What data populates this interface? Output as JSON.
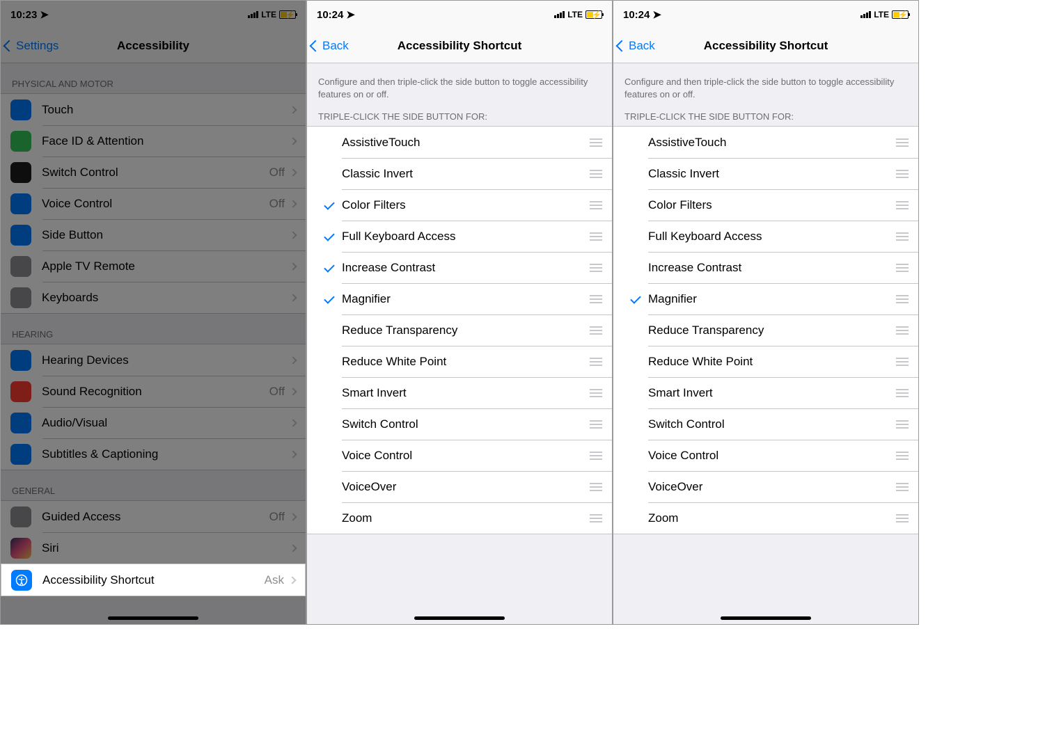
{
  "screen1": {
    "time": "10:23",
    "network": "LTE",
    "back_label": "Settings",
    "title": "Accessibility",
    "sections": {
      "physical": {
        "header": "PHYSICAL AND MOTOR",
        "items": [
          {
            "label": "Touch",
            "detail": "",
            "icon": "touch-icon",
            "bg": "bg-blue"
          },
          {
            "label": "Face ID & Attention",
            "detail": "",
            "icon": "face-icon",
            "bg": "bg-green"
          },
          {
            "label": "Switch Control",
            "detail": "Off",
            "icon": "switch-icon",
            "bg": "bg-dark"
          },
          {
            "label": "Voice Control",
            "detail": "Off",
            "icon": "voice-icon",
            "bg": "bg-blue"
          },
          {
            "label": "Side Button",
            "detail": "",
            "icon": "side-icon",
            "bg": "bg-blue"
          },
          {
            "label": "Apple TV Remote",
            "detail": "",
            "icon": "remote-icon",
            "bg": "bg-gray"
          },
          {
            "label": "Keyboards",
            "detail": "",
            "icon": "keyboard-icon",
            "bg": "bg-gray"
          }
        ]
      },
      "hearing": {
        "header": "HEARING",
        "items": [
          {
            "label": "Hearing Devices",
            "detail": "",
            "icon": "ear-icon",
            "bg": "bg-blue"
          },
          {
            "label": "Sound Recognition",
            "detail": "Off",
            "icon": "sound-icon",
            "bg": "bg-red"
          },
          {
            "label": "Audio/Visual",
            "detail": "",
            "icon": "audio-icon",
            "bg": "bg-blue"
          },
          {
            "label": "Subtitles & Captioning",
            "detail": "",
            "icon": "caption-icon",
            "bg": "bg-blue"
          }
        ]
      },
      "general": {
        "header": "GENERAL",
        "items": [
          {
            "label": "Guided Access",
            "detail": "Off",
            "icon": "lock-icon",
            "bg": "bg-gray"
          },
          {
            "label": "Siri",
            "detail": "",
            "icon": "siri-icon",
            "bg": "bg-grad"
          }
        ],
        "shortcut": {
          "label": "Accessibility Shortcut",
          "detail": "Ask",
          "icon": "shortcut-icon",
          "bg": "bg-blue"
        }
      }
    }
  },
  "screen2": {
    "time": "10:24",
    "network": "LTE",
    "back_label": "Back",
    "title": "Accessibility Shortcut",
    "desc": "Configure and then triple-click the side button to toggle accessibility features on or off.",
    "list_header": "TRIPLE-CLICK THE SIDE BUTTON FOR:",
    "items": [
      {
        "label": "AssistiveTouch",
        "checked": false
      },
      {
        "label": "Classic Invert",
        "checked": false
      },
      {
        "label": "Color Filters",
        "checked": true
      },
      {
        "label": "Full Keyboard Access",
        "checked": true
      },
      {
        "label": "Increase Contrast",
        "checked": true
      },
      {
        "label": "Magnifier",
        "checked": true
      },
      {
        "label": "Reduce Transparency",
        "checked": false
      },
      {
        "label": "Reduce White Point",
        "checked": false
      },
      {
        "label": "Smart Invert",
        "checked": false
      },
      {
        "label": "Switch Control",
        "checked": false
      },
      {
        "label": "Voice Control",
        "checked": false
      },
      {
        "label": "VoiceOver",
        "checked": false
      },
      {
        "label": "Zoom",
        "checked": false
      }
    ]
  },
  "screen3": {
    "time": "10:24",
    "network": "LTE",
    "back_label": "Back",
    "title": "Accessibility Shortcut",
    "desc": "Configure and then triple-click the side button to toggle accessibility features on or off.",
    "list_header": "TRIPLE-CLICK THE SIDE BUTTON FOR:",
    "items": [
      {
        "label": "AssistiveTouch",
        "checked": false
      },
      {
        "label": "Classic Invert",
        "checked": false
      },
      {
        "label": "Color Filters",
        "checked": false
      },
      {
        "label": "Full Keyboard Access",
        "checked": false
      },
      {
        "label": "Increase Contrast",
        "checked": false
      },
      {
        "label": "Magnifier",
        "checked": true
      },
      {
        "label": "Reduce Transparency",
        "checked": false
      },
      {
        "label": "Reduce White Point",
        "checked": false
      },
      {
        "label": "Smart Invert",
        "checked": false
      },
      {
        "label": "Switch Control",
        "checked": false
      },
      {
        "label": "Voice Control",
        "checked": false
      },
      {
        "label": "VoiceOver",
        "checked": false
      },
      {
        "label": "Zoom",
        "checked": false
      }
    ]
  }
}
